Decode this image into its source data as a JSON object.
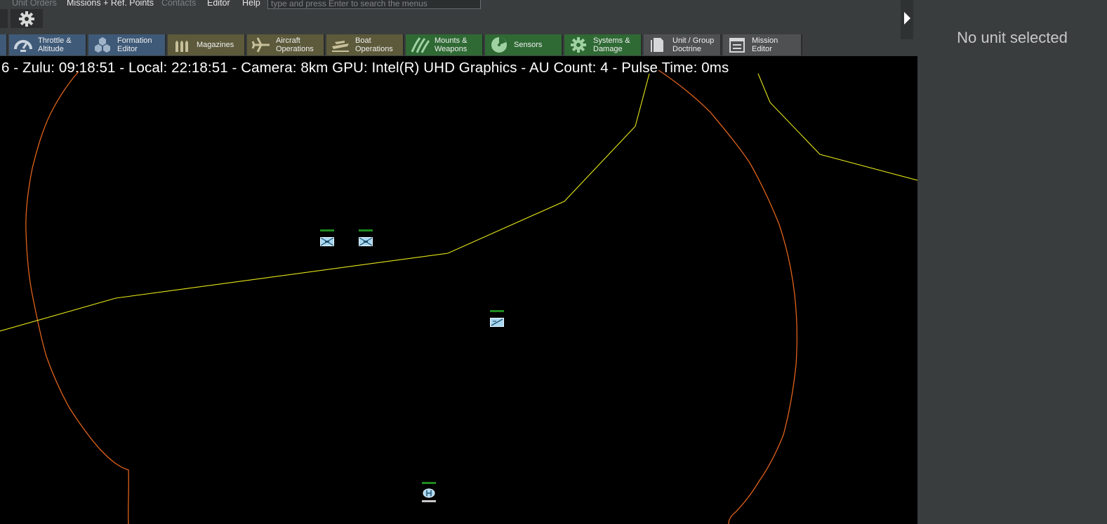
{
  "menu": {
    "unit_orders": "Unit Orders",
    "missions": "Missions + Ref. Points",
    "contacts": "Contacts",
    "editor": "Editor",
    "help": "Help",
    "search_placeholder": "type and press Enter to search the menus"
  },
  "toolbar": {
    "throttle": [
      "Throttle &",
      "Altitude"
    ],
    "formation": [
      "Formation",
      "Editor"
    ],
    "magazines": "Magazines",
    "aircraft": [
      "Aircraft",
      "Operations"
    ],
    "boat": [
      "Boat",
      "Operations"
    ],
    "mounts": [
      "Mounts &",
      "Weapons"
    ],
    "sensors": "Sensors",
    "systems": [
      "Systems &",
      "Damage"
    ],
    "doctrine": [
      "Unit / Group",
      "Doctrine"
    ],
    "mission_editor": [
      "Mission",
      "Editor"
    ]
  },
  "status_text": "6 - Zulu: 09:18:51 - Local: 22:18:51 - Camera: 8km GPU: Intel(R) UHD Graphics - AU Count: 4 - Pulse Time: 0ms",
  "side_panel": {
    "message": "No unit selected"
  },
  "colors": {
    "throttle": "#3f5a78",
    "formation": "#3f5a78",
    "magazines": "#5c5a3a",
    "aircraft": "#5c5a3a",
    "boat": "#5c5a3a",
    "mounts": "#2f6a34",
    "sensors": "#2f6a34",
    "systems": "#2f6a34",
    "doctrine": "#4e5052",
    "mission": "#4e5052",
    "friendly_unit": "#a8d8f0",
    "range_ring": "#e0621a",
    "boundary": "#e6e619"
  },
  "icons": [
    "gear-icon",
    "gauge-icon",
    "hexagons-icon",
    "bullets-icon",
    "airplane-icon",
    "boat-icon",
    "claw-icon",
    "radar-icon",
    "cog-icon",
    "document-icon",
    "clipboard-icon",
    "chevron-right-icon"
  ]
}
